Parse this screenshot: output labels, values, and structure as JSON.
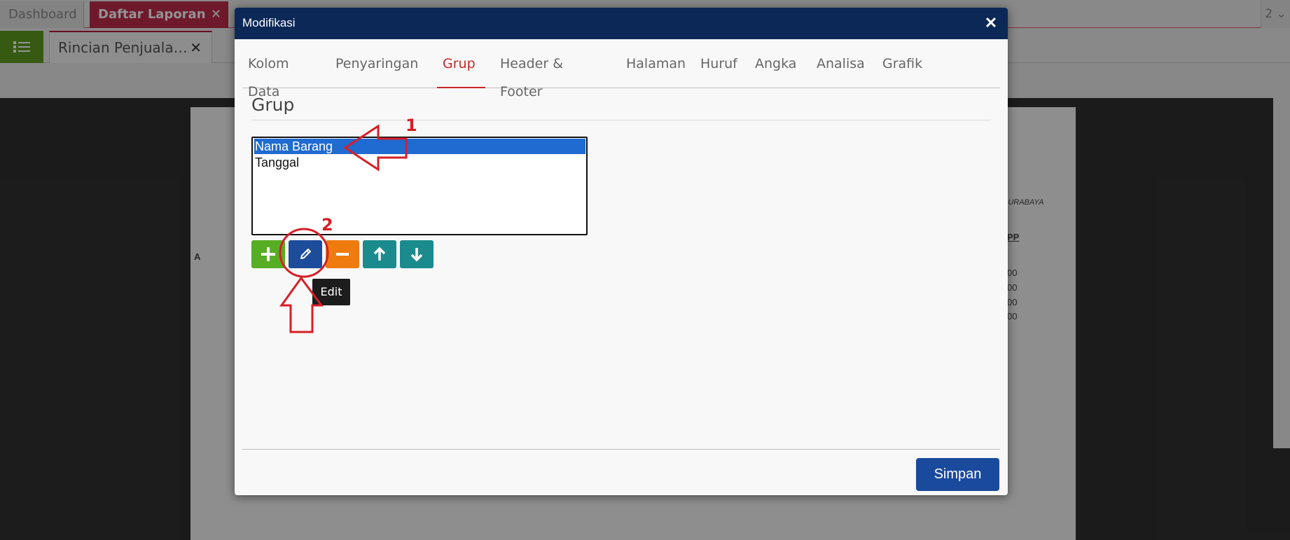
{
  "topbar": {
    "tabs": [
      {
        "label": "Dashboard"
      },
      {
        "label": "Daftar Laporan",
        "close": "✕"
      }
    ],
    "right_label": "2 ⌄"
  },
  "subbar": {
    "report_tab": {
      "label": "Rincian Penjuala…",
      "close": "✕"
    }
  },
  "paper_fragments": {
    "city": "SURABAYA",
    "col_header": "PP",
    "left_letter": "A",
    "values": [
      "00",
      "00",
      "00",
      "00"
    ]
  },
  "modal": {
    "title": "Modifikasi",
    "close": "✕",
    "tabs": [
      {
        "label": "Kolom Data"
      },
      {
        "label": "Penyaringan"
      },
      {
        "label": "Grup",
        "active": true
      },
      {
        "label": "Header & Footer"
      },
      {
        "label": "Halaman"
      },
      {
        "label": "Huruf"
      },
      {
        "label": "Angka"
      },
      {
        "label": "Analisa"
      },
      {
        "label": "Grafik"
      }
    ],
    "section_title": "Grup",
    "group_list": [
      "Nama Barang",
      "Tanggal"
    ],
    "selected_index": 0,
    "buttons": [
      {
        "name": "add",
        "icon": "plus-icon"
      },
      {
        "name": "edit",
        "icon": "pencil-icon"
      },
      {
        "name": "remove",
        "icon": "minus-icon"
      },
      {
        "name": "move-up",
        "icon": "arrow-up-icon"
      },
      {
        "name": "move-down",
        "icon": "arrow-down-icon"
      }
    ],
    "tooltip": "Edit",
    "save_label": "Simpan"
  },
  "annotations": {
    "step1": "1",
    "step2": "2",
    "color": "#d61f26"
  },
  "colors": {
    "modal_header": "#0c2857",
    "active_tab": "#c62828",
    "selection": "#1f6bd1",
    "save_button": "#1a4a9c"
  }
}
